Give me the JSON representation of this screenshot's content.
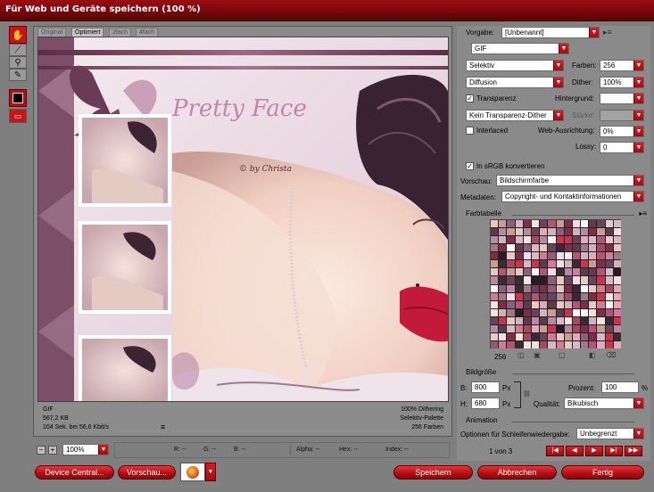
{
  "window": {
    "title": "Für Web und Geräte speichern (100 %)"
  },
  "tabs": [
    "Original",
    "Optimiert",
    "2fach",
    "4fach"
  ],
  "artwork": {
    "title": "Pretty Face",
    "signature": "© by Christa"
  },
  "info": {
    "left": [
      "GIF",
      "567,2 KB",
      "104 Sek. bei 56,6 Kbit/s"
    ],
    "right": [
      "100% Dithering",
      "Selektiv-Palette",
      "256 Farben"
    ]
  },
  "right": {
    "vorgabe_label": "Vorgabe:",
    "vorgabe_value": "[Unbenannt]",
    "format": "GIF",
    "reduction": "Selektiv",
    "farben_label": "Farben:",
    "farben_value": "256",
    "dither_algo": "Diffusion",
    "dither_label": "Dither:",
    "dither_value": "100%",
    "transparenz_label": "Transparenz",
    "hintergrund_label": "Hintergrund:",
    "transp_dither": "Kein Transparenz-Dither",
    "staerke_label": "Stärke:",
    "interlaced_label": "Interlaced",
    "web_label": "Web-Ausrichtung:",
    "web_value": "0%",
    "lossy_label": "Lossy:",
    "lossy_value": "0",
    "srgb_label": "In sRGB konvertieren",
    "vorschau_label": "Vorschau:",
    "vorschau_value": "Bildschirmfarbe",
    "metadaten_label": "Metadaten:",
    "metadaten_value": "Copyright- und Kontaktinformationen",
    "farbtabelle_label": "Farbtabelle",
    "color_count": "256",
    "bildgroesse_label": "Bildgröße",
    "b_label": "B:",
    "b_value": "800",
    "h_label": "H:",
    "h_value": "680",
    "px": "Px",
    "prozent_label": "Prozent:",
    "prozent_value": "100",
    "percent_sign": "%",
    "qualitaet_label": "Qualität:",
    "qualitaet_value": "Bikubisch",
    "animation_label": "Animation",
    "loop_label": "Optionen für Schleifenwiedergabe:",
    "loop_value": "Unbegrenzt",
    "frame_counter": "1 von 3"
  },
  "status": {
    "zoom": "100%",
    "r": "R: --",
    "g": "G: --",
    "b": "B: --",
    "alpha": "Alpha: --",
    "hex": "Hex: --",
    "index": "Index: --"
  },
  "buttons": {
    "device_central": "Device Central...",
    "vorschau": "Vorschau...",
    "speichern": "Speichern",
    "abbrechen": "Abbrechen",
    "fertig": "Fertig"
  },
  "colors": {
    "accent": "#c71319",
    "titlebar": "#8c0a0f",
    "panel": "#8a8a8a",
    "palette": [
      "#3b2a35",
      "#6a4358",
      "#8e5f78",
      "#b78aa3",
      "#d9b8c6",
      "#f2dde4",
      "#a34a5f",
      "#c9354c",
      "#7e2f47",
      "#e7c9c1",
      "#f5e4dc",
      "#c99c94",
      "#9e7a86",
      "#5c3b4b",
      "#d37b93",
      "#fff3f4",
      "#2b1b24",
      "#b45577",
      "#e6a8b8",
      "#cfb3bd"
    ]
  }
}
